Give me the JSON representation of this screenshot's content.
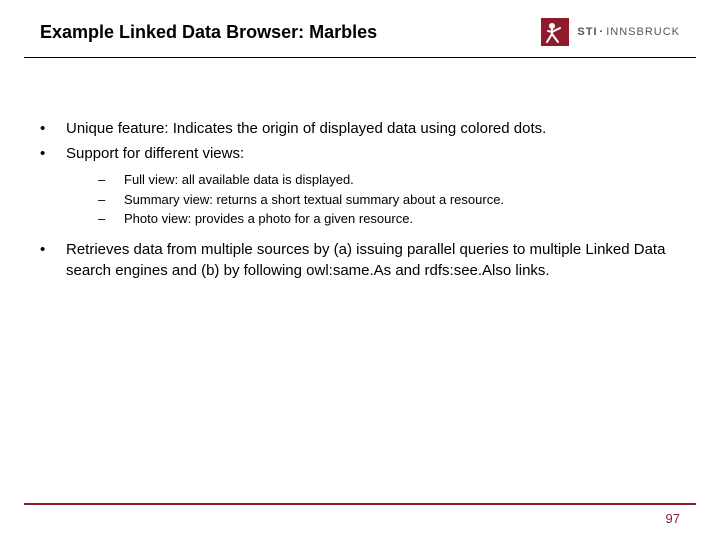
{
  "header": {
    "title": "Example Linked Data Browser: Marbles",
    "logo": {
      "brand": "STI",
      "sep": "·",
      "suffix": "INNSBRUCK"
    }
  },
  "bullets": [
    {
      "text": "Unique feature: Indicates the origin of displayed data using colored dots."
    },
    {
      "text": "Support for different views:",
      "children": [
        "Full view: all available data is displayed.",
        "Summary view: returns a short textual summary about a resource.",
        "Photo view: provides a photo for a given resource."
      ]
    },
    {
      "text": "Retrieves data from multiple sources by (a) issuing parallel queries to multiple Linked Data search engines and (b) by following owl:same.As and rdfs:see.Also links."
    }
  ],
  "footer": {
    "page": "97"
  },
  "glyphs": {
    "bullet": "•",
    "dash": "–"
  }
}
